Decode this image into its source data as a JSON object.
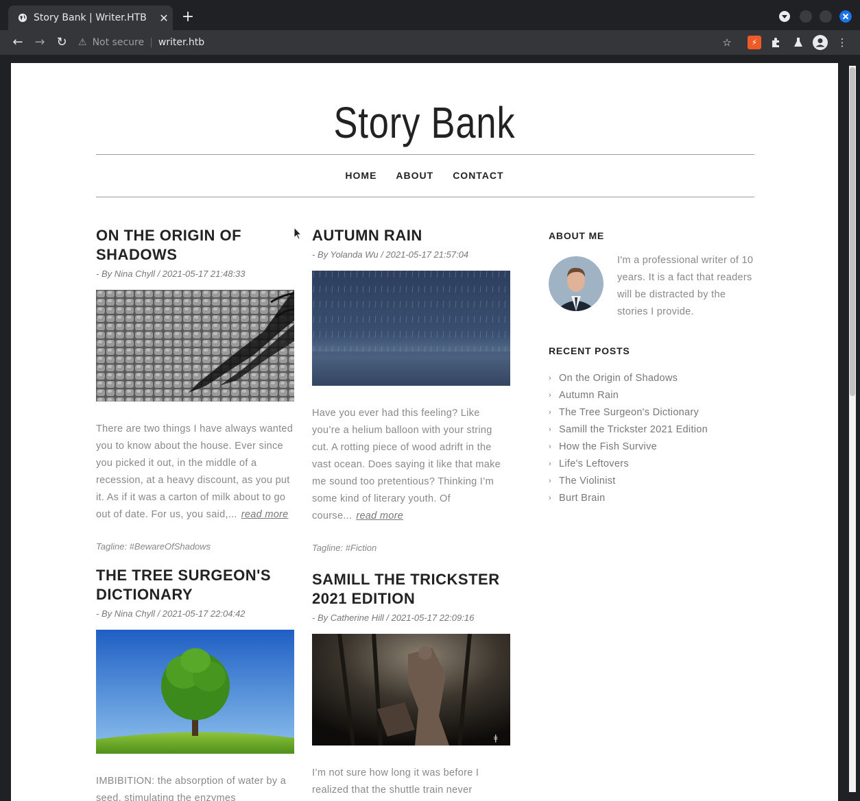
{
  "browser": {
    "tab_title": "Story Bank | Writer.HTB",
    "tab_close": "✕",
    "new_tab": "+",
    "security_label": "Not secure",
    "url": "writer.htb"
  },
  "site": {
    "title": "Story Bank",
    "menu": [
      {
        "label": "HOME"
      },
      {
        "label": "ABOUT"
      },
      {
        "label": "CONTACT"
      }
    ]
  },
  "posts": [
    {
      "title": "ON THE ORIGIN OF SHADOWS",
      "meta": "- By Nina Chyll / 2021-05-17 21:48:33",
      "excerpt": "There are two things I have always wanted you to know about the house. Ever since you picked it out, in the middle of a recession, at a heavy discount, as you put it. As if it was a carton of milk about to go out of date. For us, you said,...",
      "read_more": "read more",
      "tagline": "Tagline: #BewareOfShadows"
    },
    {
      "title": "AUTUMN RAIN",
      "meta": "- By Yolanda Wu / 2021-05-17 21:57:04",
      "excerpt": "Have you ever had this feeling? Like you’re a helium balloon with your string cut. A rotting piece of wood adrift in the vast ocean. Does saying it like that make me sound too pretentious? Thinking I’m some kind of literary youth. Of course...",
      "read_more": "read more",
      "tagline": "Tagline: #Fiction"
    },
    {
      "title": "THE TREE SURGEON'S DICTIONARY",
      "meta": "- By Nina Chyll / 2021-05-17 22:04:42",
      "excerpt": "IMBIBITION: the absorption of water by a seed, stimulating the enzymes"
    },
    {
      "title": "SAMILL THE TRICKSTER 2021 EDITION",
      "meta": "- By Catherine Hill / 2021-05-17 22:09:16",
      "excerpt": "I’m not sure how long it was before I realized that the shuttle train never"
    }
  ],
  "sidebar": {
    "about_heading": "ABOUT ME",
    "about_text": "I'm a professional writer of 10 years. It is a fact that readers will be distracted by the stories I provide.",
    "recent_heading": "RECENT POSTS",
    "recent_posts": [
      "On the Origin of Shadows",
      "Autumn Rain",
      "The Tree Surgeon's Dictionary",
      "Samill the Trickster 2021 Edition",
      "How the Fish Survive",
      "Life's Leftovers",
      "The Violinist",
      "Burt Brain"
    ]
  },
  "icons": [
    "globe-icon",
    "back-icon",
    "forward-icon",
    "reload-icon",
    "warning-icon",
    "star-icon",
    "extension-icon",
    "puzzle-icon",
    "flask-icon",
    "profile-icon",
    "menu-dots-icon",
    "chevron-right-icon"
  ]
}
